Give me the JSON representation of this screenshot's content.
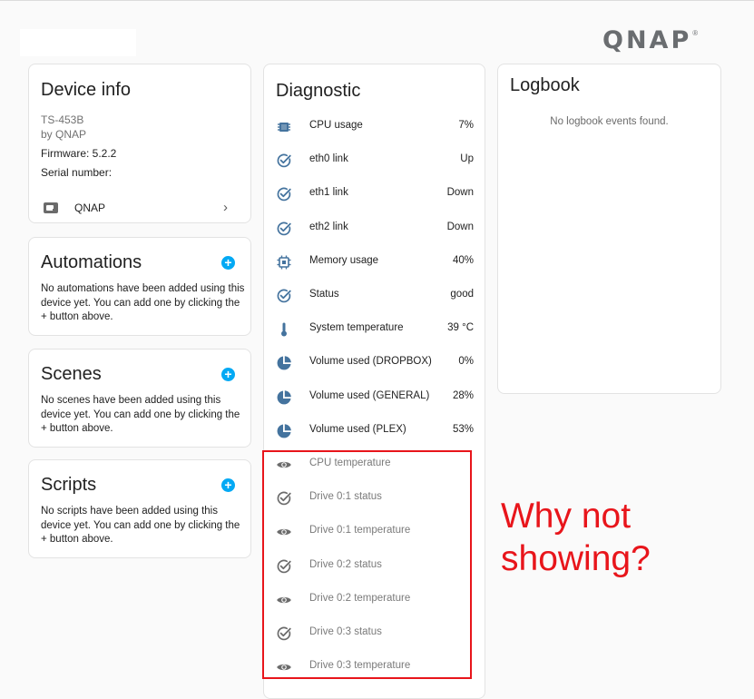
{
  "brand": {
    "logo_text": "QNAP",
    "logo_mark": "®"
  },
  "device_info": {
    "title": "Device info",
    "model": "TS-453B",
    "manufacturer": "by QNAP",
    "firmware": "Firmware: 5.2.2",
    "serial": "Serial number:",
    "link_label": "QNAP",
    "link_chevron": "›"
  },
  "automations": {
    "title": "Automations",
    "add": "+",
    "description": "No automations have been added using this device yet. You can add one by clicking the + button above."
  },
  "scenes": {
    "title": "Scenes",
    "add": "+",
    "description": "No scenes have been added using this device yet. You can add one by clicking the + button above."
  },
  "scripts": {
    "title": "Scripts",
    "add": "+",
    "description": "No scripts have been added using this device yet. You can add one by clicking the + button above."
  },
  "diagnostic": {
    "title": "Diagnostic",
    "rows": [
      {
        "label": "CPU usage",
        "value": "7%",
        "icon": "cpu-icon"
      },
      {
        "label": "eth0 link",
        "value": "Up",
        "icon": "check-circle-icon"
      },
      {
        "label": "eth1 link",
        "value": "Down",
        "icon": "check-circle-icon"
      },
      {
        "label": "eth2 link",
        "value": "Down",
        "icon": "check-circle-icon"
      },
      {
        "label": "Memory usage",
        "value": "40%",
        "icon": "memory-icon"
      },
      {
        "label": "Status",
        "value": "good",
        "icon": "check-circle-icon"
      },
      {
        "label": "System temperature",
        "value": "39 °C",
        "icon": "thermometer-icon"
      },
      {
        "label": "Volume used (DROPBOX)",
        "value": "0%",
        "icon": "pie-chart-icon"
      },
      {
        "label": "Volume used (GENERAL)",
        "value": "28%",
        "icon": "pie-chart-icon"
      },
      {
        "label": "Volume used (PLEX)",
        "value": "53%",
        "icon": "pie-chart-icon"
      },
      {
        "label": "CPU temperature",
        "value": "",
        "icon": "eye-icon"
      },
      {
        "label": "Drive 0:1 status",
        "value": "",
        "icon": "check-circle-icon"
      },
      {
        "label": "Drive 0:1 temperature",
        "value": "",
        "icon": "eye-icon"
      },
      {
        "label": "Drive 0:2 status",
        "value": "",
        "icon": "check-circle-icon"
      },
      {
        "label": "Drive 0:2 temperature",
        "value": "",
        "icon": "eye-icon"
      },
      {
        "label": "Drive 0:3 status",
        "value": "",
        "icon": "check-circle-icon"
      },
      {
        "label": "Drive 0:3 temperature",
        "value": "",
        "icon": "eye-icon"
      }
    ]
  },
  "logbook": {
    "title": "Logbook",
    "empty_text": "No logbook events found."
  },
  "annotation": {
    "text_line1": "Why not",
    "text_line2": "showing?",
    "color": "#e8151b"
  },
  "colors": {
    "accent": "#03a9f4",
    "icon_blue": "#44739e",
    "icon_gray": "#6b6b6b"
  }
}
